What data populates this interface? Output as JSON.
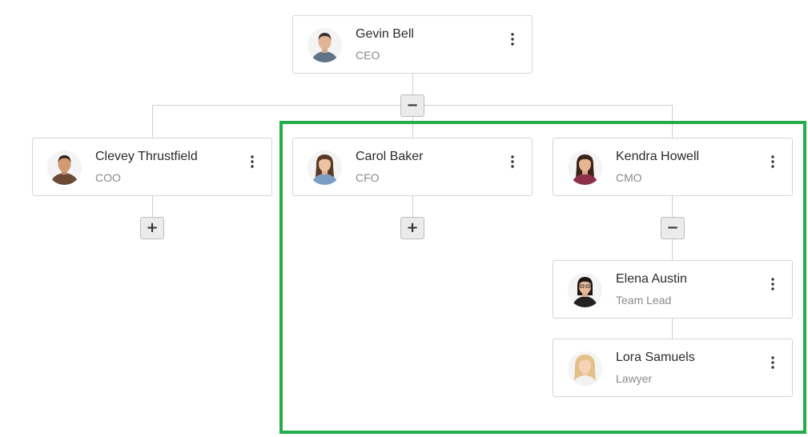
{
  "org_chart": {
    "root": {
      "name": "Gevin Bell",
      "role": "CEO",
      "avatar_icon": "man-portrait-icon",
      "toggle": "−"
    },
    "nodes": {
      "coo": {
        "name": "Clevey Thrustfield",
        "role": "COO",
        "avatar_icon": "man-portrait-icon",
        "toggle": "+"
      },
      "cfo": {
        "name": "Carol Baker",
        "role": "CFO",
        "avatar_icon": "woman-portrait-icon",
        "toggle": "+"
      },
      "cmo": {
        "name": "Kendra Howell",
        "role": "CMO",
        "avatar_icon": "woman-portrait-icon",
        "toggle": "−"
      },
      "team_lead": {
        "name": "Elena Austin",
        "role": "Team Lead",
        "avatar_icon": "woman-portrait-icon"
      },
      "lawyer": {
        "name": "Lora Samuels",
        "role": "Lawyer",
        "avatar_icon": "woman-portrait-icon"
      }
    },
    "menu_icon": "kebab-menu-icon"
  },
  "colors": {
    "highlight_border": "#24ac4b",
    "card_border": "#d6d6d6",
    "connector": "#cfcfcf",
    "toggle_bg": "#ebebeb",
    "name_text": "#2b2b2b",
    "role_text": "#8a8a8a"
  }
}
